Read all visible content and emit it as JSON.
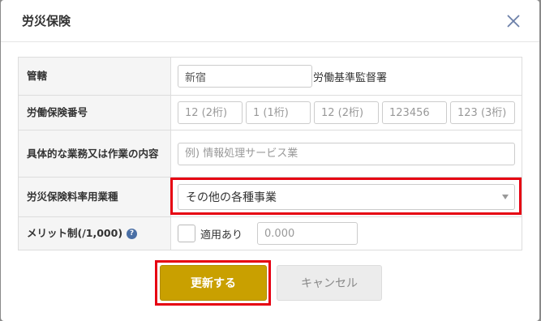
{
  "modal": {
    "title": "労災保険"
  },
  "form": {
    "jurisdiction": {
      "label": "管轄",
      "value": "新宿",
      "suffix": "労働基準監督署"
    },
    "insurance_number": {
      "label": "労働保険番号",
      "fields": [
        {
          "placeholder": "12 (2桁)"
        },
        {
          "placeholder": "1 (1桁)"
        },
        {
          "placeholder": "12 (2桁)"
        },
        {
          "placeholder": "123456"
        },
        {
          "placeholder": "123 (3桁)"
        }
      ]
    },
    "business_content": {
      "label": "具体的な業務又は作業の内容",
      "placeholder": "例) 情報処理サービス業"
    },
    "industry_type": {
      "label": "労災保険料率用業種",
      "selected": "その他の各種事業"
    },
    "merit_system": {
      "label": "メリット制(/1,000)",
      "help": "?",
      "checkbox_label": "適用あり",
      "placeholder": "0.000"
    }
  },
  "buttons": {
    "update": "更新する",
    "cancel": "キャンセル"
  },
  "colors": {
    "primary": "#c9a000",
    "highlight": "#e60012",
    "help_icon": "#4a6fa5"
  }
}
